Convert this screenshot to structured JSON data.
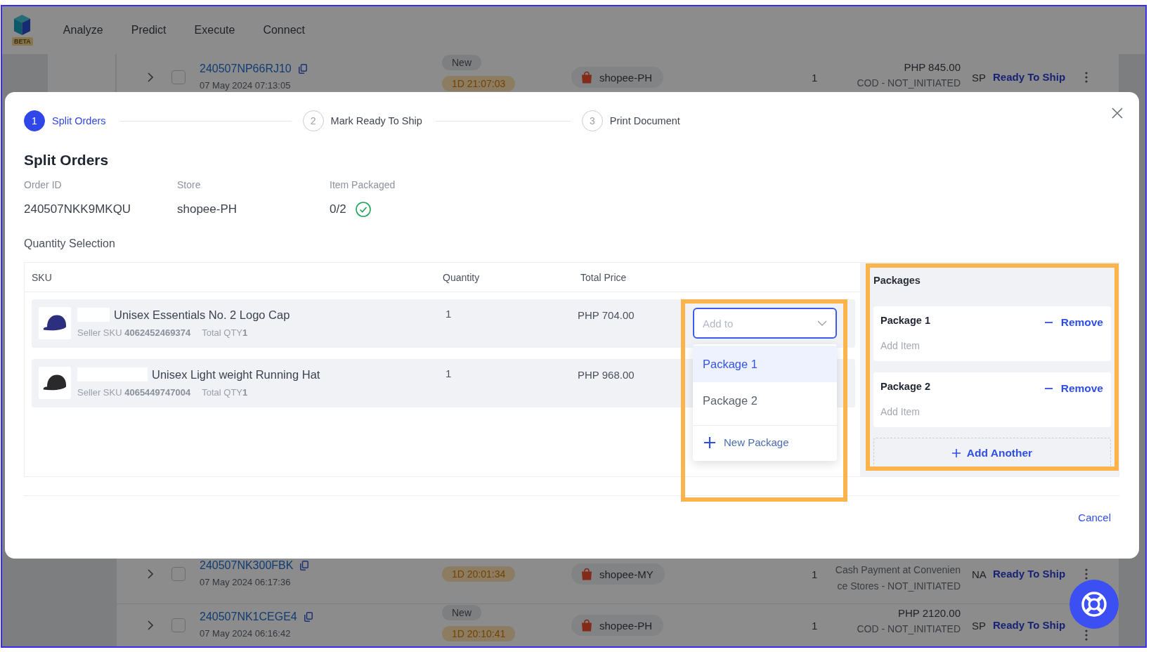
{
  "nav": {
    "beta_tag": "BETA",
    "items": [
      {
        "label": "Analyze"
      },
      {
        "label": "Predict"
      },
      {
        "label": "Execute"
      },
      {
        "label": "Connect"
      }
    ]
  },
  "orders": [
    {
      "order_id": "240507NP66RJ10",
      "date": "07 May 2024 07:13:05",
      "checked": false,
      "badges": [
        {
          "kind": "status",
          "text": "New"
        },
        {
          "kind": "timer",
          "text": "1D 21:07:03"
        }
      ],
      "store": "shopee-PH",
      "quantity": "1",
      "amount": "PHP 845.00",
      "payment_lines": [
        "COD - NOT_INITIATED"
      ],
      "code": "SP",
      "status": "Ready To Ship"
    },
    {
      "order_id": "240507NK300FBK",
      "date": "07 May 2024 06:17:36",
      "checked": false,
      "badges": [
        {
          "kind": "timer",
          "text": "1D 20:01:34"
        }
      ],
      "store": "shopee-MY",
      "quantity": "1",
      "payment_lines": [
        "Cash Payment at Convenien",
        "ce Stores - NOT_INITIATED"
      ],
      "code": "NA",
      "status": "Ready To Ship"
    },
    {
      "order_id": "240507NK1CEGE4",
      "date": "07 May 2024 06:16:42",
      "checked": false,
      "badges": [
        {
          "kind": "status",
          "text": "New"
        },
        {
          "kind": "timer",
          "text": "1D 20:10:41"
        }
      ],
      "store": "shopee-PH",
      "quantity": "1",
      "amount": "PHP 2120.00",
      "payment_lines": [
        "COD - NOT_INITIATED"
      ],
      "code": "SP",
      "status": "Ready To Ship"
    }
  ],
  "modal": {
    "steps": [
      {
        "number": "1",
        "label": "Split Orders",
        "active": true
      },
      {
        "number": "2",
        "label": "Mark Ready To Ship",
        "active": false
      },
      {
        "number": "3",
        "label": "Print Document",
        "active": false
      }
    ],
    "title": "Split Orders",
    "fields": [
      {
        "kind": "text",
        "label": "Order ID",
        "value": "240507NKK9MKQU"
      },
      {
        "kind": "text",
        "label": "Store",
        "value": "shopee-PH"
      },
      {
        "kind": "check",
        "label": "Item Packaged",
        "value": "0/2"
      }
    ],
    "section_title": "Quantity Selection",
    "table": {
      "columns": [
        "SKU",
        "Quantity",
        "Total Price"
      ],
      "rows": [
        {
          "name": "Unisex Essentials No. 2 Logo Cap",
          "sku_line": "Seller SKU **4062452469374**",
          "qty_line": "Total QTY**1**",
          "quantity": "1",
          "total_price": "PHP 704.00",
          "color": "#2b2f7e",
          "add_to": {
            "placeholder": "Add to",
            "open": true,
            "highlighted": true,
            "options": [
              {
                "label": "Package 1",
                "selected": true
              },
              {
                "label": "Package 2",
                "selected": false
              }
            ],
            "new_option": "New Package"
          }
        },
        {
          "name": "Unisex Light weight Running Hat",
          "sku_line": "Seller SKU **4065449747004**",
          "qty_line": "Total QTY**1**",
          "quantity": "1",
          "total_price": "PHP 968.00",
          "color": "#2a2a2c"
        }
      ]
    },
    "packages": {
      "title": "Packages",
      "highlighted": true,
      "items": [
        {
          "name": "Package 1",
          "action": "Remove",
          "placeholder": "Add Item"
        },
        {
          "name": "Package 2",
          "action": "Remove",
          "placeholder": "Add Item"
        }
      ],
      "add_button": "Add Another"
    },
    "cancel": "Cancel"
  }
}
